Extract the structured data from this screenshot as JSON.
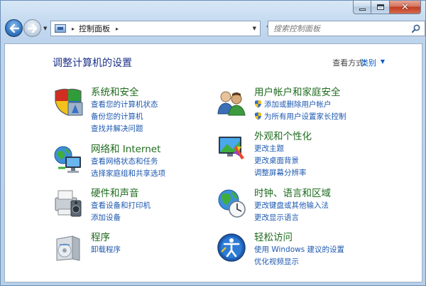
{
  "window": {
    "caption_buttons": {
      "minimize": "–",
      "maximize": "□",
      "close": "✕"
    }
  },
  "nav": {
    "back_icon": "back-arrow-icon",
    "forward_icon": "forward-arrow-icon",
    "breadcrumb_root_sep": "▸",
    "breadcrumb": "控制面板",
    "breadcrumb_sep": "▸",
    "refresh_icon": "refresh-icon",
    "search_placeholder": "搜索控制面板"
  },
  "header": {
    "title": "调整计算机的设置",
    "view_by_label": "查看方式:",
    "view_by_value": "类别",
    "view_by_caret": "▼"
  },
  "categories": {
    "system_security": {
      "title": "系统和安全",
      "links": [
        "查看您的计算机状态",
        "备份您的计算机",
        "查找并解决问题"
      ],
      "icon": "system-security-icon"
    },
    "network": {
      "title": "网络和 Internet",
      "links": [
        "查看网络状态和任务",
        "选择家庭组和共享选项"
      ],
      "icon": "network-icon"
    },
    "hardware": {
      "title": "硬件和声音",
      "links": [
        "查看设备和打印机",
        "添加设备"
      ],
      "icon": "hardware-sound-icon"
    },
    "programs": {
      "title": "程序",
      "links": [
        "卸载程序"
      ],
      "icon": "programs-icon"
    },
    "user_accounts": {
      "title": "用户帐户和家庭安全",
      "links": [
        "添加或删除用户帐户",
        "为所有用户设置家长控制"
      ],
      "icon": "user-accounts-icon"
    },
    "appearance": {
      "title": "外观和个性化",
      "links": [
        "更改主题",
        "更改桌面背景",
        "调整屏幕分辨率"
      ],
      "icon": "appearance-icon"
    },
    "clock": {
      "title": "时钟、语言和区域",
      "links": [
        "更改键盘或其他输入法",
        "更改显示语言"
      ],
      "icon": "clock-language-region-icon"
    },
    "ease": {
      "title": "轻松访问",
      "links": [
        "使用 Windows 建议的设置",
        "优化视频显示"
      ],
      "icon": "ease-of-access-icon"
    }
  },
  "colors": {
    "category_title": "#1f6b1f",
    "link": "#1d58b0",
    "page_title": "#1e3287"
  }
}
